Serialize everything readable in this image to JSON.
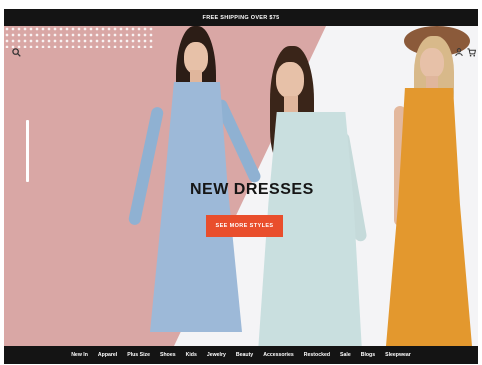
{
  "promo_bar": {
    "text": "FREE SHIPPING OVER $75"
  },
  "hero": {
    "headline": "NEW DRESSES",
    "cta_label": "SEE MORE STYLES",
    "colors": {
      "accent": "#e94e2c",
      "pink_panel": "#d9a7a5",
      "dark": "#141414"
    }
  },
  "header_icons": [
    "search-icon",
    "user-icon",
    "cart-icon"
  ],
  "nav": {
    "items": [
      {
        "label": "New In"
      },
      {
        "label": "Apparel"
      },
      {
        "label": "Plus Size"
      },
      {
        "label": "Shoes"
      },
      {
        "label": "Kids"
      },
      {
        "label": "Jewelry"
      },
      {
        "label": "Beauty"
      },
      {
        "label": "Accessories"
      },
      {
        "label": "Restocked"
      },
      {
        "label": "Sale"
      },
      {
        "label": "Blogs"
      },
      {
        "label": "Sleepwear"
      }
    ]
  }
}
